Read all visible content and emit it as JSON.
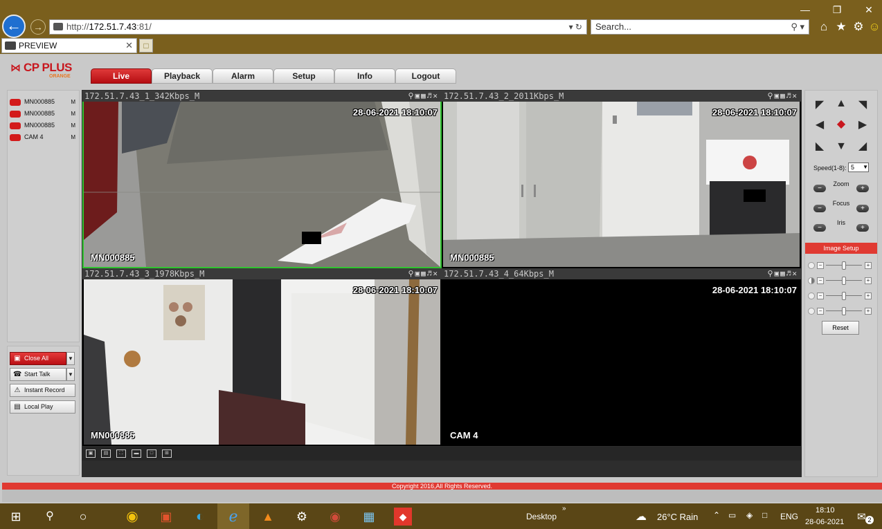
{
  "browser": {
    "url_prefix": "http://",
    "url_host": "172.51.7.43",
    "url_rest": ":81/",
    "search_placeholder": "Search...",
    "tab_title": "PREVIEW"
  },
  "app": {
    "logo_text": "CP PLUS",
    "logo_sub": "ORANGE",
    "nav": [
      "Live",
      "Playback",
      "Alarm",
      "Setup",
      "Info",
      "Logout"
    ],
    "active_nav": "Live"
  },
  "devices": [
    {
      "name": "MN000885",
      "flag": "M"
    },
    {
      "name": "MN000885",
      "flag": "M"
    },
    {
      "name": "MN000885",
      "flag": "M"
    },
    {
      "name": "CAM 4",
      "flag": "M"
    }
  ],
  "controls": {
    "close_all": "Close All",
    "start_talk": "Start Talk",
    "instant_record": "Instant Record",
    "local_play": "Local Play"
  },
  "cells": [
    {
      "header": "172.51.7.43_1_342Kbps_M",
      "timestamp": "28-06-2021 18:10:07",
      "cam_name": "MN000885"
    },
    {
      "header": "172.51.7.43_2_2011Kbps_M",
      "timestamp": "28-06-2021 18:10:07",
      "cam_name": "MN000885"
    },
    {
      "header": "172.51.7.43_3_1978Kbps_M",
      "timestamp": "28-06-2021 18:10:07",
      "cam_name": "MN000885"
    },
    {
      "header": "172.51.7.43_4_64Kbps_M",
      "timestamp": "28-06-2021 18:10:07",
      "cam_name": "CAM 4"
    }
  ],
  "ptz": {
    "speed_label": "Speed(1-8):",
    "speed_value": "5",
    "zoom_label": "Zoom",
    "focus_label": "Focus",
    "iris_label": "Iris",
    "image_setup": "Image Setup",
    "reset": "Reset"
  },
  "footer": {
    "copyright": "Copyright 2016,All Rights Reserved."
  },
  "taskbar": {
    "desktop": "Desktop",
    "weather": "26°C  Rain",
    "lang": "ENG",
    "time": "18:10",
    "date": "28-06-2021",
    "notifications": "2"
  },
  "colors": {
    "accent_red": "#c8171e",
    "selected_green": "#2fc42f",
    "chrome_brown": "#7a5f1d"
  }
}
